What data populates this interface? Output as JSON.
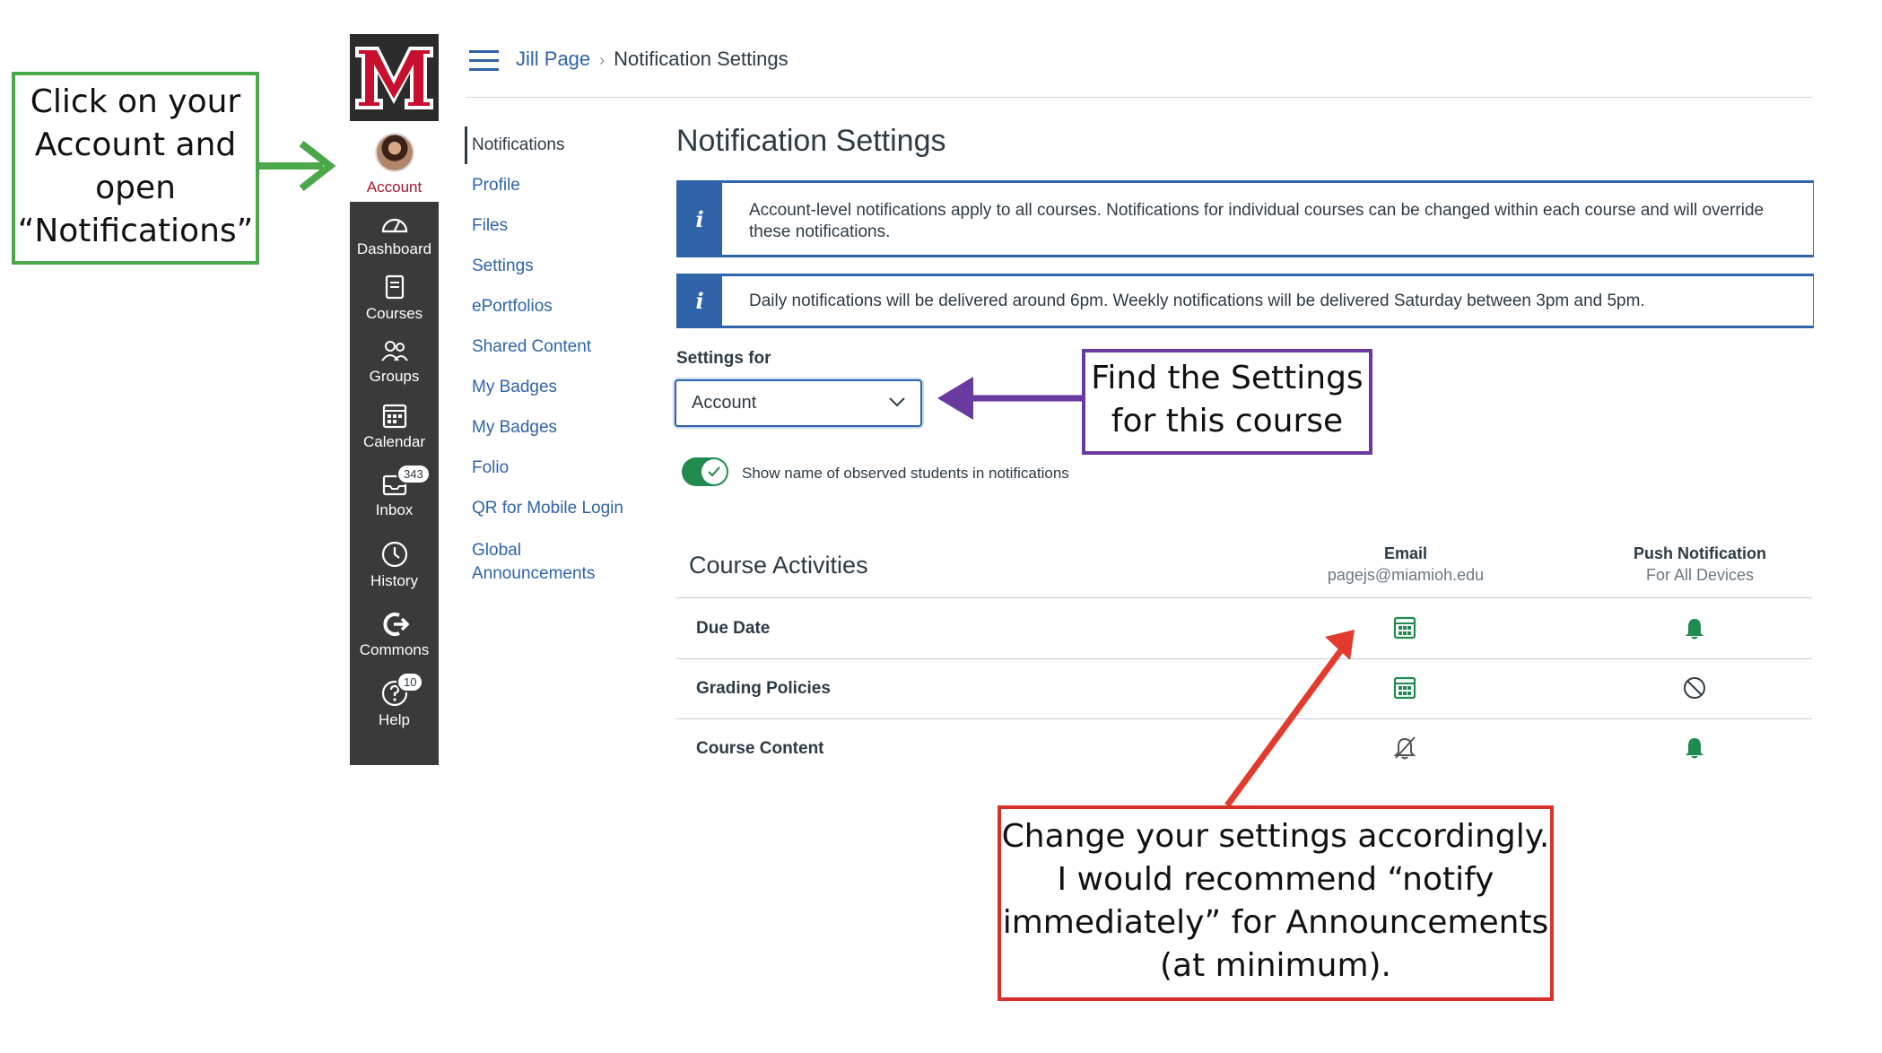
{
  "nav": {
    "account_label": "Account",
    "items": [
      {
        "label": "Dashboard",
        "icon": "dashboard-icon"
      },
      {
        "label": "Courses",
        "icon": "courses-icon"
      },
      {
        "label": "Groups",
        "icon": "groups-icon"
      },
      {
        "label": "Calendar",
        "icon": "calendar-icon"
      },
      {
        "label": "Inbox",
        "icon": "inbox-icon",
        "badge": "343"
      },
      {
        "label": "History",
        "icon": "history-icon"
      },
      {
        "label": "Commons",
        "icon": "commons-icon"
      },
      {
        "label": "Help",
        "icon": "help-icon",
        "badge": "10"
      }
    ],
    "logo_letter": "M"
  },
  "breadcrumb": {
    "user": "Jill Page",
    "current": "Notification Settings"
  },
  "subnav": {
    "items": [
      "Notifications",
      "Profile",
      "Files",
      "Settings",
      "ePortfolios",
      "Shared Content",
      "My Badges",
      "My Badges",
      "Folio",
      "QR for Mobile Login",
      "Global Announcements"
    ],
    "global_line1": "Global",
    "global_line2": "Announcements",
    "active_index": 0
  },
  "main": {
    "title": "Notification Settings",
    "alert1": "Account-level notifications apply to all courses. Notifications for individual courses can be changed within each course and will override these notifications.",
    "alert2": "Daily notifications will be delivered around 6pm. Weekly notifications will be delivered Saturday between 3pm and 5pm.",
    "alert_icon": "i",
    "settings_for_label": "Settings for",
    "settings_for_value": "Account",
    "toggle_label": "Show name of observed students in notifications",
    "toggle_on": true,
    "section_title": "Course Activities",
    "email_header": "Email",
    "email_address": "pagejs@miamioh.edu",
    "push_header": "Push Notification",
    "push_sub": "For All Devices",
    "rows": [
      {
        "label": "Due Date",
        "email": "calendar-icon",
        "push": "bell-icon"
      },
      {
        "label": "Grading Policies",
        "email": "calendar-icon",
        "push": "prohibited-icon"
      },
      {
        "label": "Course Content",
        "email": "bell-off-icon",
        "push": "bell-icon"
      }
    ]
  },
  "annotations": {
    "green": [
      "Click on your",
      "Account and",
      "open",
      "“Notifications”"
    ],
    "purple": [
      "Find the Settings",
      "for this course"
    ],
    "red": [
      "Change your settings accordingly.",
      "I would recommend “notify",
      "immediately” for Announcements",
      "(at minimum)."
    ]
  },
  "colors": {
    "brand": "#a6192e",
    "link": "#2f64a8",
    "success": "#1f8b4e",
    "green_annotation": "#4aa84a",
    "purple_annotation": "#6a3aa0",
    "red_annotation": "#d9302b"
  }
}
